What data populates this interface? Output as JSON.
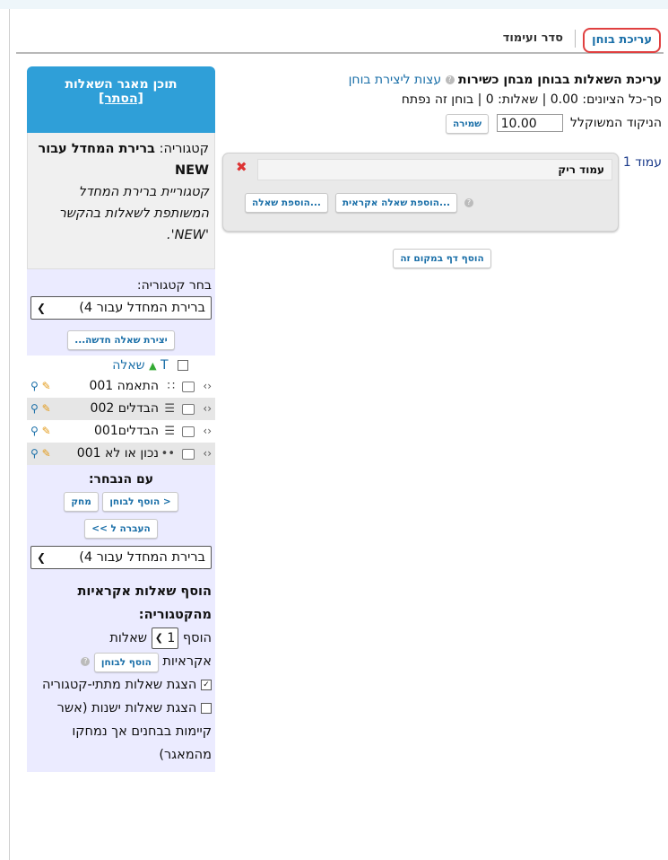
{
  "tabs": {
    "edit": "עריכת בוחן",
    "order": "סדר ועימוד"
  },
  "sidebar": {
    "header_title": "תוכן מאגר השאלות",
    "header_hide": "[הסתר]",
    "category_label": "קטגוריה:",
    "category_name": "ברירת המחדל עבור NEW",
    "category_desc": "קטגוריית ברירת המחדל המשותפת לשאלות בהקשר 'NEW'.",
    "choose_label": "בחר קטגוריה:",
    "choose_value": "ברירת המחדל עבור 4)",
    "new_question": "יצירת שאלה חדשה...",
    "list_head_t": "T",
    "list_head_label": "שאלה",
    "questions": [
      {
        "name": "התאמה 001",
        "icon": "match-icon"
      },
      {
        "name": "הבדלים 002",
        "icon": "multichoice-icon"
      },
      {
        "name": "הבדלים001",
        "icon": "multichoice-icon"
      },
      {
        "name": "נכון או לא 001",
        "icon": "truefalse-icon"
      }
    ],
    "with_selected": "עם הנבחר:",
    "add_to_quiz_btn": "< הוסף לבוחן",
    "delete_btn": "מחק",
    "move_btn": "העברה ל >>",
    "move_select": "ברירת המחדל עבור 4)",
    "random_head": "הוסף שאלות אקראיות מהקטגוריה:",
    "random_add": "הוסף",
    "random_count": "1",
    "random_questions": "שאלות",
    "random_random": "אקראיות",
    "random_btn": "הוסף לבוחן",
    "show_sub": "הצגת שאלות מתתי-קטגוריה",
    "show_old": "הצגת שאלות ישנות (אשר קיימות בבחנים אך נמחקו מהמאגר)"
  },
  "main": {
    "title": "עריכת השאלות בבוחן מבחן כשירות",
    "tips_link": "עצות ליצירת בוחן",
    "summary": "סך-כל הציונים: 0.00 | שאלות: 0 | בוחן זה נפתח",
    "max_grade_label": "הניקוד המשוקלל",
    "max_grade_value": "10.00",
    "save_btn": "שמירה",
    "page_label": "עמוד 1",
    "empty_page": "עמוד ריק",
    "add_random_btn": "הוספת שאלה אקראית...",
    "add_question_btn": "הוספת שאלה...",
    "add_page_btn": "הוסף דף במקום זה"
  }
}
